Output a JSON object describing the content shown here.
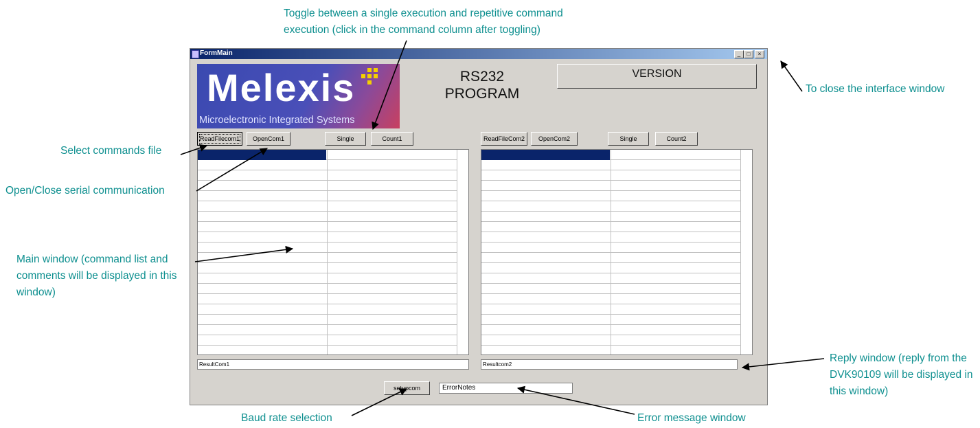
{
  "window": {
    "title": "FormMain",
    "controls": {
      "minimize": "_",
      "maximize": "□",
      "close": "×"
    },
    "logo": {
      "word": "Melexis",
      "subtitle": "Microelectronic Integrated Systems"
    },
    "program_title": [
      "RS232",
      "PROGRAM"
    ],
    "version_label": "VERSION"
  },
  "toolbar1": {
    "read_label": "ReadFilecom1",
    "open_label": "OpenCom1",
    "single_label": "Single",
    "count_label": "Count1"
  },
  "toolbar2": {
    "read_label": "ReadFileCom2",
    "open_label": "OpenCom2",
    "single_label": "Single",
    "count_label": "Count2"
  },
  "results": {
    "com1": "ResultCom1",
    "com2": "Resultcom2"
  },
  "bottom": {
    "setup_label": "setupcom",
    "error_text": "ErrorNotes"
  },
  "annotations": {
    "toggle": [
      "Toggle between a single execution and repetitive command",
      "execution (click in the command column  after toggling)"
    ],
    "close": "To close the interface window",
    "select": "Select commands file",
    "open_close": "Open/Close serial communication",
    "main": [
      "Main window (command list and",
      "comments will be displayed in this",
      "window)"
    ],
    "reply": [
      "Reply window (reply from the",
      "DVK90109 will be displayed in",
      "this window)"
    ],
    "baud": "Baud rate selection",
    "error": "Error message window"
  },
  "colors": {
    "annotation": "#0d8f8f",
    "title_bar": "#0a246a",
    "selection": "#0a246a",
    "face": "#d6d3ce"
  }
}
